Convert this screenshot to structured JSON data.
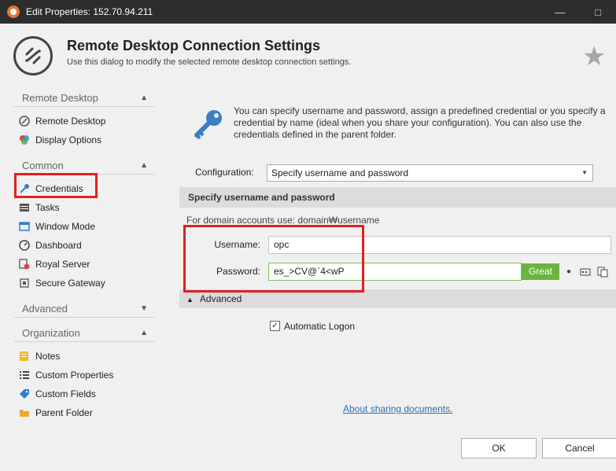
{
  "window": {
    "title": "Edit Properties: 152.70.94.211",
    "minimize": "—",
    "maximize": "□"
  },
  "header": {
    "title": "Remote Desktop Connection Settings",
    "subtitle": "Use this dialog to modify the selected remote desktop connection settings."
  },
  "sidebar": {
    "sections": [
      {
        "label": "Remote Desktop",
        "expanded": true,
        "items": [
          {
            "label": "Remote Desktop",
            "icon": "remote-desktop-icon"
          },
          {
            "label": "Display Options",
            "icon": "display-options-icon"
          }
        ]
      },
      {
        "label": "Common",
        "expanded": true,
        "items": [
          {
            "label": "Credentials",
            "icon": "key-icon",
            "selected": true
          },
          {
            "label": "Tasks",
            "icon": "tasks-icon"
          },
          {
            "label": "Window Mode",
            "icon": "window-mode-icon"
          },
          {
            "label": "Dashboard",
            "icon": "dashboard-icon"
          },
          {
            "label": "Royal Server",
            "icon": "royal-server-icon"
          },
          {
            "label": "Secure Gateway",
            "icon": "secure-gateway-icon"
          }
        ]
      },
      {
        "label": "Advanced",
        "expanded": false,
        "items": []
      },
      {
        "label": "Organization",
        "expanded": true,
        "items": [
          {
            "label": "Notes",
            "icon": "notes-icon"
          },
          {
            "label": "Custom Properties",
            "icon": "custom-properties-icon"
          },
          {
            "label": "Custom Fields",
            "icon": "custom-fields-icon"
          },
          {
            "label": "Parent Folder",
            "icon": "folder-icon"
          }
        ]
      }
    ]
  },
  "main": {
    "info_text": "You can specify username and password, assign a predefined credential or you specify a credential by name (ideal when you share your configuration). You can also use the credentials defined in the parent folder.",
    "configuration_label": "Configuration:",
    "configuration_value": "Specify username and password",
    "section_title": "Specify username and password",
    "domain_note": "For domain accounts use: domain₩username",
    "username_label": "Username:",
    "username_value": "opc",
    "password_label": "Password:",
    "password_value": "es_>CV@`4<wP",
    "password_strength": "Great",
    "advanced_label": "Advanced",
    "automatic_logon_label": "Automatic Logon",
    "automatic_logon_checked": true,
    "sharing_link": "About sharing documents."
  },
  "buttons": {
    "ok": "OK",
    "cancel": "Cancel"
  },
  "colors": {
    "titlebar": "#2d2d2d",
    "highlight": "#e02020",
    "strength_green": "#6db33f",
    "link": "#2a6ebb"
  }
}
